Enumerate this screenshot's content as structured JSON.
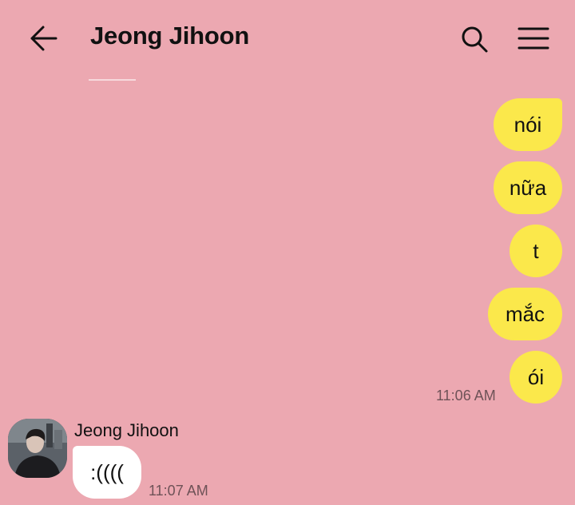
{
  "header": {
    "title": "Jeong Jihoon",
    "back_icon": "arrow-left-icon",
    "search_icon": "search-icon",
    "menu_icon": "hamburger-menu-icon"
  },
  "colors": {
    "background": "#eca8b1",
    "outgoing_bubble": "#fbe84b",
    "incoming_bubble": "#ffffff"
  },
  "messages": {
    "outgoing": [
      {
        "text": "nói"
      },
      {
        "text": "nữa"
      },
      {
        "text": "t"
      },
      {
        "text": "mắc"
      },
      {
        "text": "ói"
      }
    ],
    "outgoing_time": "11:06 AM",
    "incoming": {
      "sender": "Jeong Jihoon",
      "text": ":((((",
      "time": "11:07 AM"
    }
  }
}
